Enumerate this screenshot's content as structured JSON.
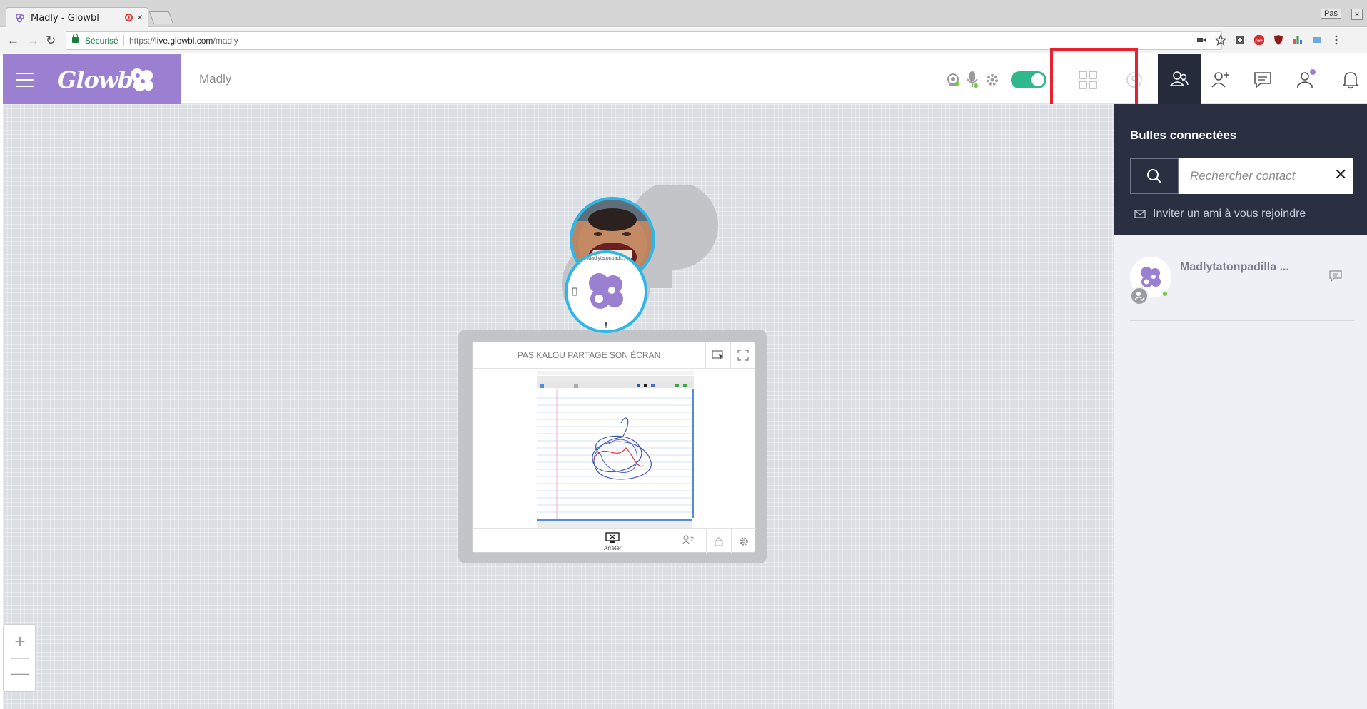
{
  "browser": {
    "tab_title": "Madly - Glowbl",
    "tab_close": "×",
    "window_user": "Pas",
    "window_close": "×",
    "secure_label": "Sécurisé",
    "url_scheme": "https://",
    "url_host": "live.glowbl.com",
    "url_path": "/madly",
    "nav_back": "←",
    "nav_forward": "→",
    "nav_reload": "↻"
  },
  "header": {
    "logo": "Glowbl",
    "room_name": "Madly",
    "icons": [
      "menu-icon",
      "webcam-icon",
      "microphone-icon",
      "settings-icon",
      "toggle",
      "grid-view-icon",
      "avatar-view-icon",
      "contacts-icon",
      "add-user-icon",
      "chat-icon",
      "participants-icon",
      "notifications-icon"
    ],
    "accent_color": "#9b7fd0",
    "toggle_color": "#2fb98a",
    "highlight_color": "#e8212f"
  },
  "canvas": {
    "zoom_in": "+",
    "zoom_out": "—",
    "bubble_me_label": "Madlytatonpadi..."
  },
  "screen_share": {
    "title": "PAS KALOU PARTAGE SON ÉCRAN",
    "stop_label": "Arrêter",
    "participants_count": "2"
  },
  "panel": {
    "title": "Bulles connectées",
    "search_placeholder": "Rechercher contact",
    "clear": "✕",
    "invite_text": "Inviter un ami à vous rejoindre",
    "contacts": [
      {
        "name": "Madlytatonpadilla ...",
        "status": "online"
      }
    ]
  }
}
